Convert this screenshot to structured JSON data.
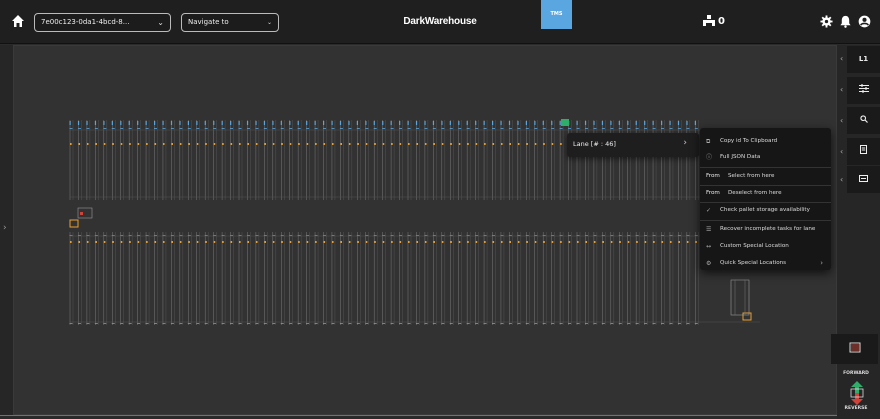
{
  "header": {
    "warehouse_id": "7e00c123-0da1-4bcd-8...",
    "navigate_placeholder": "Navigate to",
    "brand": "DarkWarehouse",
    "tms_label": "TMS",
    "counter": "0"
  },
  "right_panel": {
    "level": "L1"
  },
  "lane_tooltip": {
    "label": "Lane [# : 46]",
    "chevron": "›"
  },
  "context_menu": {
    "items": [
      {
        "icon": "copy-icon",
        "label": "Copy id To Clipboard"
      },
      {
        "icon": "info-icon",
        "label": "Full JSON Data"
      },
      {
        "prefix": "From",
        "label": "Select from here"
      },
      {
        "prefix": "From",
        "label": "Deselect from here"
      },
      {
        "icon": "check-icon",
        "label": "Check pallet storage availability"
      },
      {
        "icon": "tasks-icon",
        "label": "Recover incomplete tasks for lane"
      },
      {
        "icon": "arrows-icon",
        "label": "Custom Special Location"
      },
      {
        "icon": "gear-icon",
        "label": "Quick Special Locations",
        "submenu": true
      }
    ]
  },
  "controls": {
    "forward": "FORWARD",
    "reverse": "REVERSE"
  },
  "colors": {
    "accent_blue": "#5aa6e0",
    "lane_orange": "#e8a030",
    "lane_blue": "#5aa6e0",
    "highlight_green": "#2fae6a",
    "forward_green": "#2fae6a",
    "reverse_red": "#d0433a"
  }
}
